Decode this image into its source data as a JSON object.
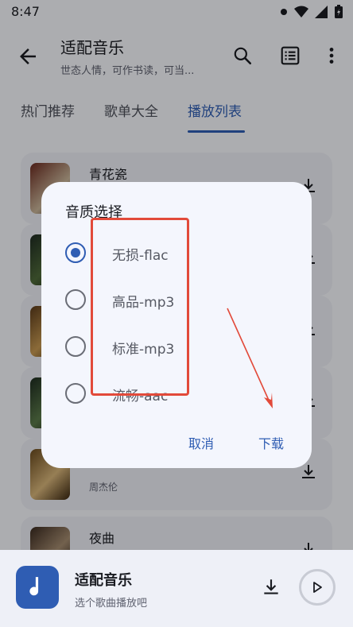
{
  "status_bar": {
    "time": "8:47"
  },
  "header": {
    "title": "适配音乐",
    "subtitle": "世态人情，可作书读，可当..."
  },
  "tabs": [
    {
      "label": "热门推荐",
      "active": false
    },
    {
      "label": "歌单大全",
      "active": false
    },
    {
      "label": "播放列表",
      "active": true
    }
  ],
  "songs": [
    {
      "name": "青花瓷",
      "artist": ""
    },
    {
      "name": "",
      "artist": ""
    },
    {
      "name": "",
      "artist": ""
    },
    {
      "name": "",
      "artist": ""
    },
    {
      "name": "",
      "artist": "周杰伦"
    },
    {
      "name": "夜曲",
      "artist": ""
    }
  ],
  "player": {
    "title": "适配音乐",
    "subtitle": "选个歌曲播放吧"
  },
  "dialog": {
    "title": "音质选择",
    "options": [
      {
        "label": "无损-flac",
        "selected": true
      },
      {
        "label": "高品-mp3",
        "selected": false
      },
      {
        "label": "标准-mp3",
        "selected": false
      },
      {
        "label": "流畅-aac",
        "selected": false
      }
    ],
    "cancel_label": "取消",
    "download_label": "下载"
  },
  "colors": {
    "accent": "#2f5db3",
    "annotation": "#e24a3a"
  }
}
